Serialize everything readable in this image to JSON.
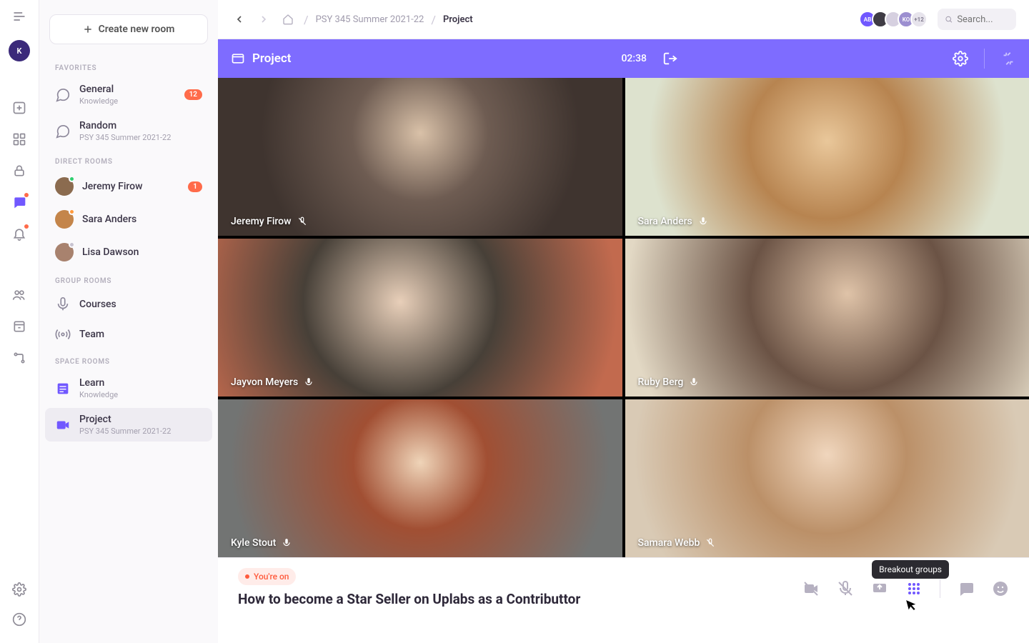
{
  "rail": {
    "user_initial": "K"
  },
  "topbar": {
    "breadcrumb": {
      "course": "PSY 345 Summer 2021-22",
      "page": "Project"
    },
    "avatars": [
      "AB",
      "",
      "",
      "KO"
    ],
    "avatar_more": "+12",
    "search_placeholder": "Search..."
  },
  "sidebar": {
    "create_button": "Create new room",
    "sections": {
      "favorites": {
        "heading": "FAVORITES",
        "items": [
          {
            "title": "General",
            "sub": "Knowledge",
            "badge": "12"
          },
          {
            "title": "Random",
            "sub": "PSY 345 Summer 2021-22"
          }
        ]
      },
      "direct": {
        "heading": "DIRECT ROOMS",
        "items": [
          {
            "title": "Jeremy Firow",
            "badge": "1",
            "presence": "online"
          },
          {
            "title": "Sara Anders",
            "presence": "away"
          },
          {
            "title": "Lisa Dawson",
            "presence": "offline"
          }
        ]
      },
      "group": {
        "heading": "GROUP ROOMS",
        "items": [
          {
            "title": "Courses"
          },
          {
            "title": "Team"
          }
        ]
      },
      "space": {
        "heading": "SPACE ROOMS",
        "items": [
          {
            "title": "Learn",
            "sub": "Knowledge"
          },
          {
            "title": "Project",
            "sub": "PSY 345 Summer 2021-22",
            "selected": true
          }
        ]
      }
    }
  },
  "video": {
    "title": "Project",
    "time": "02:38",
    "tiles": [
      {
        "name": "Jeremy Firow",
        "muted": true
      },
      {
        "name": "Sara Anders",
        "muted": false,
        "active": true
      },
      {
        "name": "Jayvon Meyers",
        "muted": false
      },
      {
        "name": "Ruby Berg",
        "muted": false
      },
      {
        "name": "Kyle Stout",
        "muted": false
      },
      {
        "name": "Samara Webb",
        "muted": true
      }
    ]
  },
  "footer": {
    "status": "You're on",
    "title": "How to become a Star Seller on Uplabs as a Contributtor",
    "tooltip": "Breakout groups"
  }
}
